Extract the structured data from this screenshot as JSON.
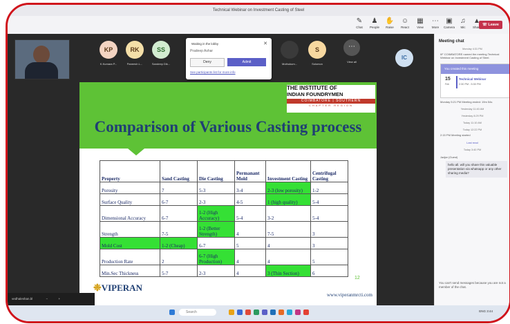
{
  "window": {
    "title": "Technical Webinar on Investment Casting of Steel"
  },
  "toolbar": {
    "chat": "Chat",
    "people": "People",
    "raise": "Raise",
    "react": "React",
    "view": "View",
    "more": "More",
    "camera": "Camera",
    "mic": "Mic",
    "share": "Share",
    "leave": "Leave"
  },
  "participants": [
    {
      "initials": "KP",
      "name": "K.Kumara P...",
      "color": "#f3d4c2"
    },
    {
      "initials": "RK",
      "name": "Paneesh L...",
      "color": "#f4dfa8"
    },
    {
      "initials": "SS",
      "name": "Sandeep Dik...",
      "color": "#d2ecd0"
    },
    {
      "initials": "",
      "name": "Muthukum...",
      "color": "#3a3a3a"
    },
    {
      "initials": "S",
      "name": "Solomon",
      "color": "#f7d8a0"
    }
  ],
  "view_all": "View all",
  "tile_ic": "IC",
  "lobby": {
    "header": "Waiting in the lobby",
    "name": "Pradeep Ashar",
    "deny": "Deny",
    "admit": "Admit",
    "link": "See participants list for more info"
  },
  "slide": {
    "title": "Comparison of Various Casting process",
    "logo": {
      "line1": "THE INSTITUTE OF",
      "line2": "INDIAN FOUNDRYMEN",
      "line3": "COIMBATORE | SOUTHERN",
      "line4": "CHAPTER REGION"
    },
    "table": {
      "headers": [
        "Property",
        "Sand Casting",
        "Die Casting",
        "Permanant Mold",
        "Investment Casting",
        "Centrifugal Casting"
      ],
      "rows": [
        [
          "Porosity",
          "7",
          "5-3",
          "3-4",
          "2-3 (low porosity)",
          "1-2"
        ],
        [
          "Surface Quality",
          "6-7",
          "2-3",
          "4-5",
          "1 (high quality)",
          "5-4"
        ],
        [
          "Dimensional Accuracy",
          "6-7",
          "1-2 (High Accuracy)",
          "5-4",
          "3-2",
          "5-4"
        ],
        [
          "Strength",
          "7-5",
          "1-2 (Better Strength)",
          "4",
          "7-5",
          "3"
        ],
        [
          "Mold Cost",
          "1-2 (Cheap)",
          "6-7",
          "5",
          "4",
          "3"
        ],
        [
          "Production Rate",
          "2",
          "6-7 (High Production)",
          "4",
          "4",
          "5"
        ],
        [
          "Min.Sec Thickness",
          "5-7",
          "2-3",
          "4",
          "3 (Thin Section)",
          "6"
        ]
      ],
      "highlights": [
        [
          0,
          4
        ],
        [
          1,
          4
        ],
        [
          2,
          2
        ],
        [
          3,
          2
        ],
        [
          4,
          0
        ],
        [
          4,
          1
        ],
        [
          5,
          2
        ],
        [
          6,
          4
        ]
      ]
    },
    "brand": "VIPERAN",
    "page": "12",
    "url": "www.viperanmrcti.com"
  },
  "self_name": "vedhaleshan.bl",
  "chat": {
    "title": "Meeting chat",
    "t1": "Monday 4:31 PM",
    "e1": "IIF COIMBATORE named the meeting Technical Webinar on Investment Casting of Steel.",
    "card_head": "You created this meeting",
    "card_day": "15",
    "card_month": "Feb",
    "card_title": "Technical Webinar",
    "card_time": "2:30 PM - 5:30 PM",
    "e2": "Monday 5:21 PM   Meeting ended: 19m 54s",
    "times": [
      "Yesterday 11:40 AM",
      "Yesterday 8:29 PM",
      "Today 11:10 AM",
      "Today 12:22 PM"
    ],
    "started": "2:15 PM   Meeting started",
    "last_read": "Last read",
    "t_last": "Today 3:40 PM",
    "guest": "Jadjar (Guest)",
    "message": "hello all. will you share this valuable presentation via whatsapp or any other sharing media?",
    "noreply": "You can't send messages because you are not a member of the chat."
  },
  "taskbar": {
    "search": "Search",
    "time": "ENG 3:44"
  }
}
